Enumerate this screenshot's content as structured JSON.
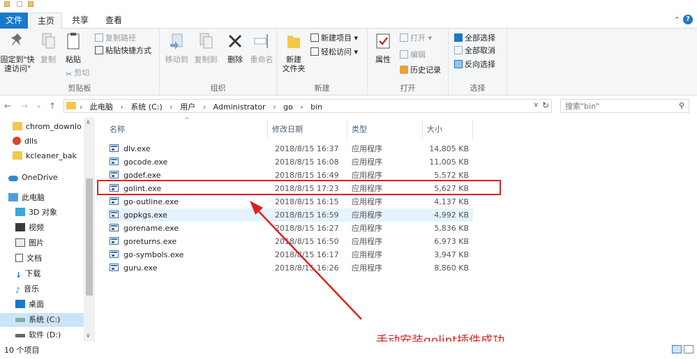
{
  "tabs": {
    "file": "文件",
    "home": "主页",
    "share": "共享",
    "view": "查看"
  },
  "ribbon": {
    "clipboard": {
      "pin": "固定到\"快\n速访问\"",
      "copy": "复制",
      "paste": "粘贴",
      "copy_path": "复制路径",
      "paste_shortcut": "粘贴快捷方式",
      "cut": "剪切",
      "label": "剪贴板"
    },
    "organize": {
      "move_to": "移动到",
      "copy_to": "复制到",
      "delete": "删除",
      "rename": "重命名",
      "label": "组织"
    },
    "new": {
      "new_folder": "新建\n文件夹",
      "new_item": "新建项目 ▾",
      "easy_access": "轻松访问 ▾",
      "label": "新建"
    },
    "open": {
      "properties": "属性",
      "open": "打开 ▾",
      "edit": "编辑",
      "history": "历史记录",
      "label": "打开"
    },
    "select": {
      "select_all": "全部选择",
      "select_none": "全部取消",
      "invert": "反向选择",
      "label": "选择"
    }
  },
  "address": {
    "crumbs": [
      "此电脑",
      "系统 (C:)",
      "用户",
      "Administrator",
      "go",
      "bin"
    ],
    "search_placeholder": "搜索\"bin\""
  },
  "nav": [
    {
      "label": "chrom_downlo",
      "icon": "folder-icon"
    },
    {
      "label": "dlls",
      "icon": "folder-alert-icon"
    },
    {
      "label": "kcleaner_bak",
      "icon": "folder-icon"
    },
    {
      "label": "OneDrive",
      "icon": "cloud-icon"
    },
    {
      "label": "此电脑",
      "icon": "computer-icon"
    },
    {
      "label": "3D 对象",
      "icon": "cube-icon"
    },
    {
      "label": "视频",
      "icon": "video-icon"
    },
    {
      "label": "图片",
      "icon": "picture-icon"
    },
    {
      "label": "文档",
      "icon": "document-icon"
    },
    {
      "label": "下载",
      "icon": "download-icon"
    },
    {
      "label": "音乐",
      "icon": "music-icon"
    },
    {
      "label": "桌面",
      "icon": "desktop-icon"
    },
    {
      "label": "系统 (C:)",
      "icon": "drive-icon"
    },
    {
      "label": "软件 (D:)",
      "icon": "drive-icon"
    }
  ],
  "columns": {
    "name": "名称",
    "date": "修改日期",
    "type": "类型",
    "size": "大小"
  },
  "files": [
    {
      "name": "dlv.exe",
      "date": "2018/8/15 16:37",
      "type": "应用程序",
      "size": "14,805 KB"
    },
    {
      "name": "gocode.exe",
      "date": "2018/8/15 16:08",
      "type": "应用程序",
      "size": "11,005 KB"
    },
    {
      "name": "godef.exe",
      "date": "2018/8/15 16:49",
      "type": "应用程序",
      "size": "5,572 KB"
    },
    {
      "name": "golint.exe",
      "date": "2018/8/15 17:23",
      "type": "应用程序",
      "size": "5,627 KB"
    },
    {
      "name": "go-outline.exe",
      "date": "2018/8/15 16:15",
      "type": "应用程序",
      "size": "4,137 KB"
    },
    {
      "name": "gopkgs.exe",
      "date": "2018/8/15 16:59",
      "type": "应用程序",
      "size": "4,992 KB"
    },
    {
      "name": "gorename.exe",
      "date": "2018/8/15 16:27",
      "type": "应用程序",
      "size": "5,836 KB"
    },
    {
      "name": "goreturns.exe",
      "date": "2018/8/15 16:50",
      "type": "应用程序",
      "size": "6,973 KB"
    },
    {
      "name": "go-symbols.exe",
      "date": "2018/8/15 16:17",
      "type": "应用程序",
      "size": "3,947 KB"
    },
    {
      "name": "guru.exe",
      "date": "2018/8/15 16:26",
      "type": "应用程序",
      "size": "8,860 KB"
    }
  ],
  "annotation": "手动安装golint插件成功",
  "status": {
    "count": "10 个项目"
  },
  "colors": {
    "accent": "#1979ca",
    "annotation": "#e02020",
    "selection": "#cce4f7"
  }
}
